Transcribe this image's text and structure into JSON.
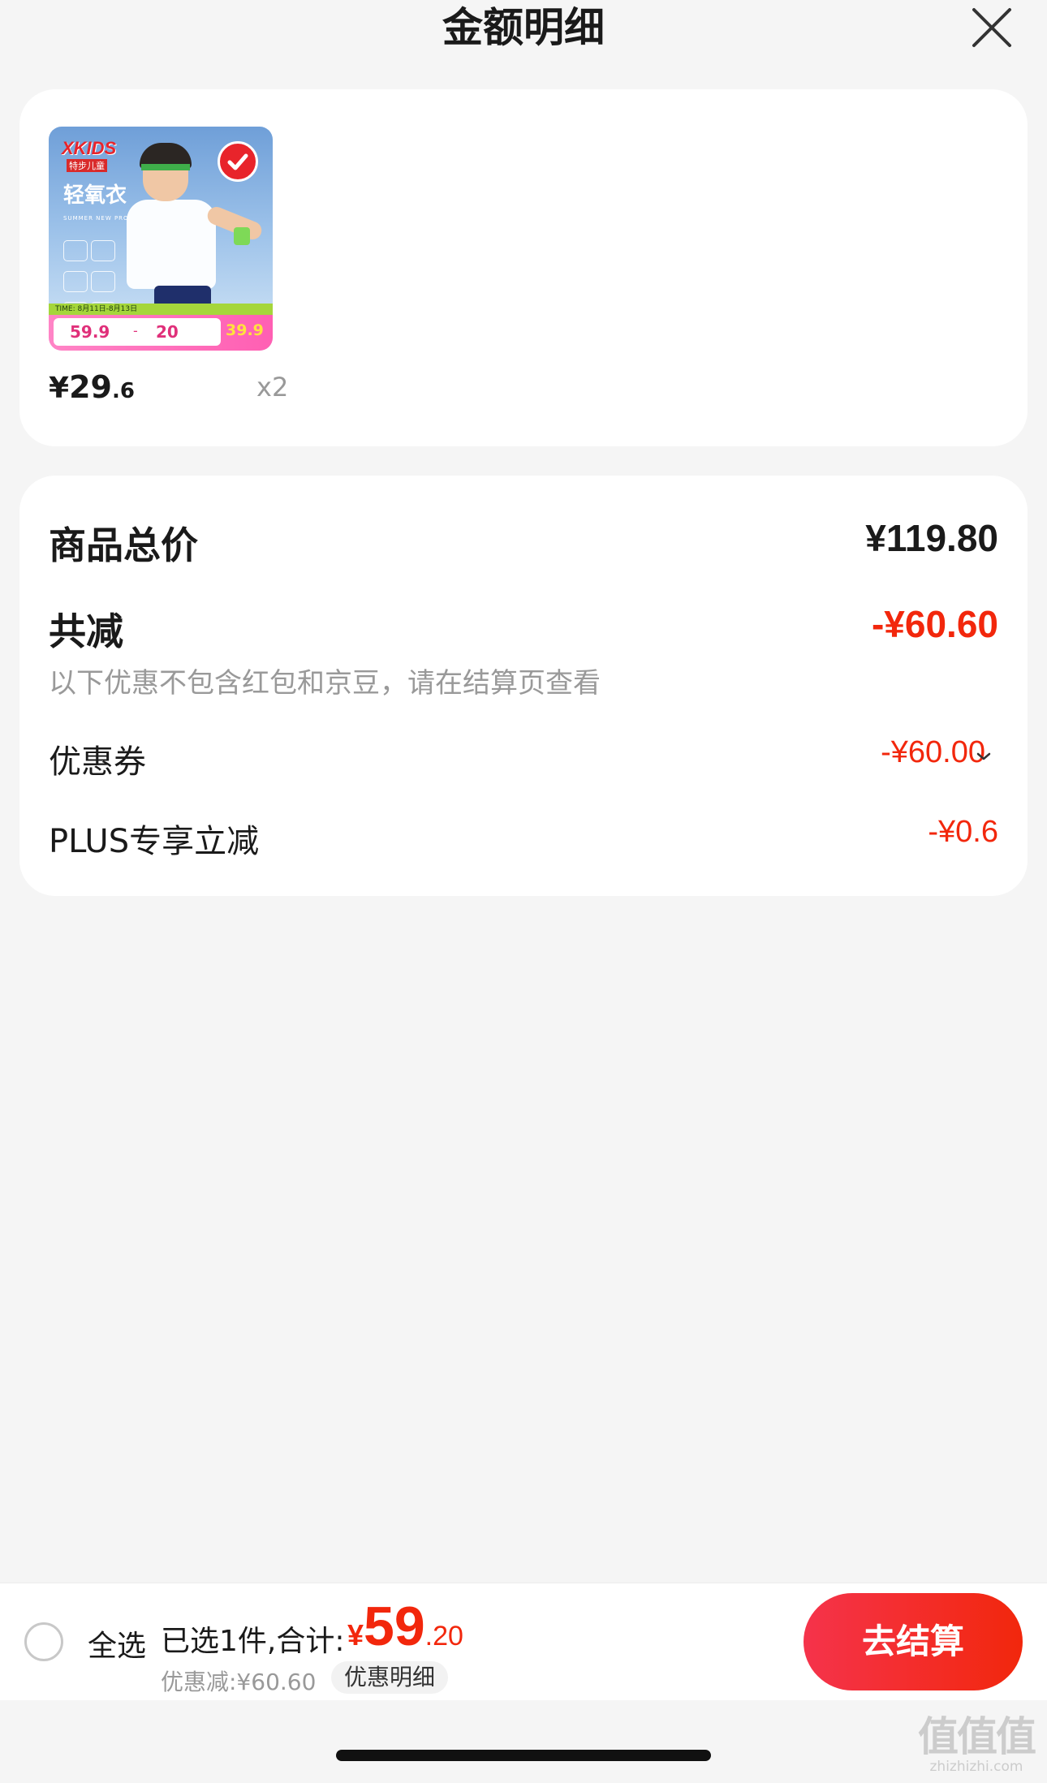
{
  "header": {
    "title": "金额明细"
  },
  "product": {
    "thumbnail": {
      "brand": "XKIDS",
      "brand_sub": "特步儿童",
      "tagline": "轻氧衣",
      "summer_text": "SUMMER NEW PRODUCT",
      "time_text": "TIME: 8月11日-8月13日",
      "price_1": "59.9",
      "price_2": "20",
      "price_3": "39.9"
    },
    "price_currency": "¥",
    "price_int": "29",
    "price_dec": ".6",
    "quantity": "x2",
    "selected": true
  },
  "summary": {
    "total_label": "商品总价",
    "total_value": "¥119.80",
    "reduce_label": "共减",
    "reduce_value": "-¥60.60",
    "reduce_note": "以下优惠不包含红包和京豆，请在结算页查看",
    "coupon_label": "优惠券",
    "coupon_value": "-¥60.00",
    "plus_label": "PLUS专享立减",
    "plus_value": "-¥0.6"
  },
  "bottom_bar": {
    "select_all": "全选",
    "selected_text": "已选1件,合计:",
    "total_currency": "¥",
    "total_int": "59",
    "total_dec": ".20",
    "discount_text": "优惠减:¥60.60",
    "detail_chip": "优惠明细",
    "checkout": "去结算"
  },
  "watermark": {
    "logo": "值值值",
    "url": "zhizhizhi.com"
  },
  "colors": {
    "accent": "#f2270c",
    "background": "#f5f5f5",
    "card": "#ffffff"
  }
}
